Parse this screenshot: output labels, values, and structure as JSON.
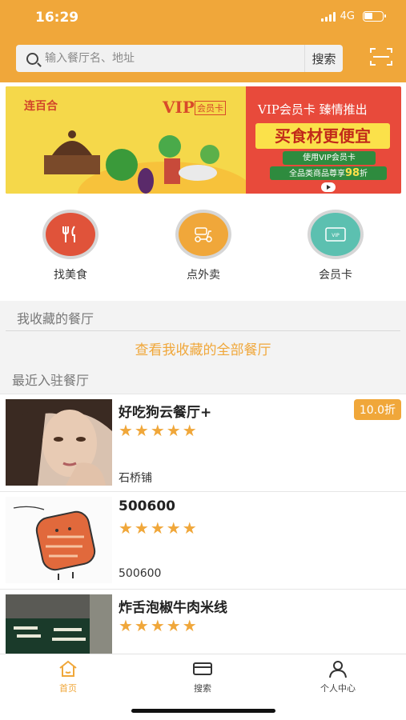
{
  "status": {
    "time": "16:29",
    "network": "4G"
  },
  "search": {
    "placeholder": "输入餐厅名、地址",
    "button_label": "搜索"
  },
  "banner": {
    "logo": "连百合",
    "vip": "VIP",
    "vip_sub": "会员卡",
    "title1": "VIP会员卡  臻情推出",
    "title2": "买食材更便宜",
    "pill1": "使用VIP会员卡",
    "pill2_prefix": "全品类商品尊享",
    "pill2_discount": "98",
    "pill2_suffix": "折"
  },
  "categories": [
    {
      "label": "找美食",
      "icon": "fork-knife-icon",
      "color": "#e0533a"
    },
    {
      "label": "点外卖",
      "icon": "scooter-icon",
      "color": "#f0a73a"
    },
    {
      "label": "会员卡",
      "icon": "vip-card-icon",
      "color": "#5cc0b0"
    }
  ],
  "favorites": {
    "title": "我收藏的餐厅",
    "link": "查看我收藏的全部餐厅"
  },
  "recent": {
    "title": "最近入驻餐厅",
    "restaurants": [
      {
        "name": "好吃狗云餐厅+",
        "stars": "★★★★★",
        "address": "石桥铺",
        "badge": "10.0折"
      },
      {
        "name": "500600",
        "stars": "★★★★★",
        "address": "500600",
        "badge": ""
      },
      {
        "name": "炸舌泡椒牛肉米线",
        "stars": "★★★★★",
        "address": "",
        "badge": ""
      }
    ]
  },
  "tabbar": [
    {
      "label": "首页",
      "icon": "home-icon"
    },
    {
      "label": "搜索",
      "icon": "card-icon"
    },
    {
      "label": "个人中心",
      "icon": "person-icon"
    }
  ],
  "colors": {
    "brand": "#f0a73a",
    "banner_red": "#e84a3b"
  }
}
